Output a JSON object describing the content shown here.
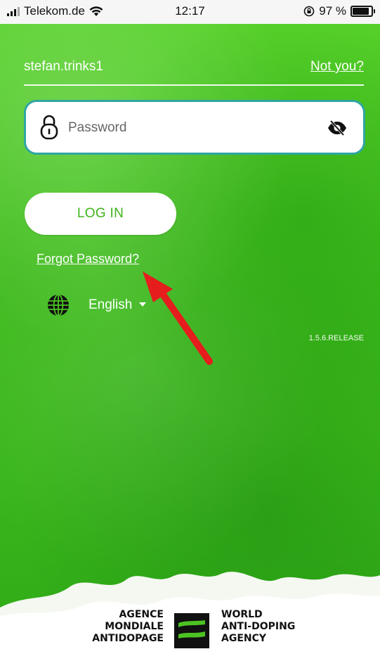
{
  "status_bar": {
    "carrier": "Telekom.de",
    "time": "12:17",
    "battery_percent": "97 %",
    "battery_level": 0.97
  },
  "login": {
    "username": "stefan.trinks1",
    "not_you": "Not you?",
    "password_placeholder": "Password",
    "login_button": "LOG IN",
    "forgot_password": "Forgot Password?",
    "language": "English",
    "version": "1.5.6.RELEASE"
  },
  "footer": {
    "left_lines": [
      "AGENCE",
      "MONDIALE",
      "ANTIDOPAGE"
    ],
    "right_lines": [
      "WORLD",
      "ANTI-DOPING",
      "AGENCY"
    ]
  },
  "icons": [
    "signal-icon",
    "wifi-icon",
    "lock-rotation-icon",
    "battery-icon",
    "lock-icon",
    "eye-slash-icon",
    "globe-icon",
    "chevron-down-icon",
    "red-arrow-icon"
  ],
  "colors": {
    "background_green": "#3fbb1d",
    "button_text_green": "#3fb41b",
    "input_border_teal": "#2fa6a3",
    "annotation_red": "#e51d1d"
  }
}
